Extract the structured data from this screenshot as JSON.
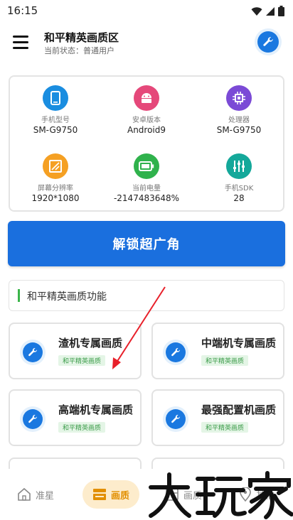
{
  "status_bar": {
    "time": "16:15"
  },
  "header": {
    "title": "和平精英画质区",
    "subtitle": "当前状态：普通用户"
  },
  "device_info": [
    {
      "label": "手机型号",
      "value": "SM-G9750",
      "icon": "phone-icon",
      "color": "#1a8de0"
    },
    {
      "label": "安卓版本",
      "value": "Android9",
      "icon": "android-icon",
      "color": "#e5487a"
    },
    {
      "label": "处理器",
      "value": "SM-G9750",
      "icon": "chip-icon",
      "color": "#7b4ad6"
    },
    {
      "label": "屏幕分辨率",
      "value": "1920*1080",
      "icon": "screen-resolution-icon",
      "color": "#f5a023"
    },
    {
      "label": "当前电量",
      "value": "-2147483648%",
      "icon": "battery-icon",
      "color": "#2fb24c"
    },
    {
      "label": "手机SDK",
      "value": "28",
      "icon": "sliders-icon",
      "color": "#14a89a"
    }
  ],
  "unlock_button": {
    "label": "解锁超广角"
  },
  "section": {
    "title": "和平精英画质功能"
  },
  "features": [
    {
      "title": "渣机专属画质",
      "badge": "和平精英画质"
    },
    {
      "title": "中端机专属画质",
      "badge": "和平精英画质"
    },
    {
      "title": "高端机专属画质",
      "badge": "和平精英画质"
    },
    {
      "title": "最强配置机画质",
      "badge": "和平精英画质"
    }
  ],
  "bottom_nav": [
    {
      "label": "准星",
      "icon": "home-icon",
      "active": false
    },
    {
      "label": "画质",
      "icon": "image-quality-icon",
      "active": true
    },
    {
      "label": "画质",
      "icon": "frame-icon",
      "active": false
    },
    {
      "label": "其他",
      "icon": "location-icon",
      "active": false
    }
  ],
  "watermark": {
    "text": "大玩家"
  },
  "colors": {
    "primary": "#1a6fde",
    "accent_green": "#3bb54a",
    "active_nav": "#e28f00"
  }
}
